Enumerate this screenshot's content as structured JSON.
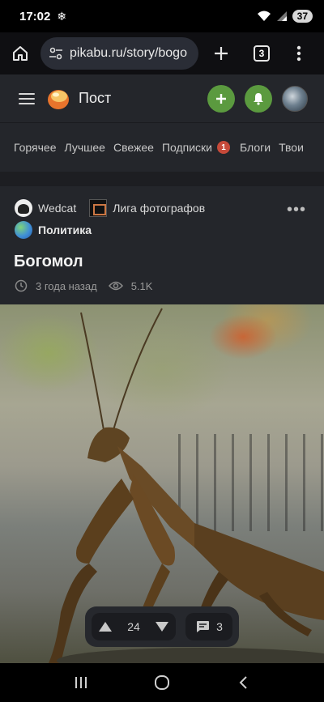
{
  "status_bar": {
    "time": "17:02",
    "battery": "37"
  },
  "browser": {
    "url": "pikabu.ru/story/bogo",
    "tab_count": "3"
  },
  "site": {
    "title": "Пост"
  },
  "categories": [
    {
      "label": "Горячее"
    },
    {
      "label": "Лучшее"
    },
    {
      "label": "Свежее"
    },
    {
      "label": "Подписки",
      "badge": "1"
    },
    {
      "label": "Блоги"
    },
    {
      "label": "Твои"
    }
  ],
  "post": {
    "author": "Wedcat",
    "community": "Лига фотографов",
    "tag": "Политика",
    "title": "Богомол",
    "time_ago": "3 года назад",
    "views": "5.1K",
    "rating": "24",
    "comments": "3"
  },
  "colors": {
    "accent_green": "#5b9a3f",
    "badge_red": "#c64a3a",
    "background": "#24262b"
  }
}
